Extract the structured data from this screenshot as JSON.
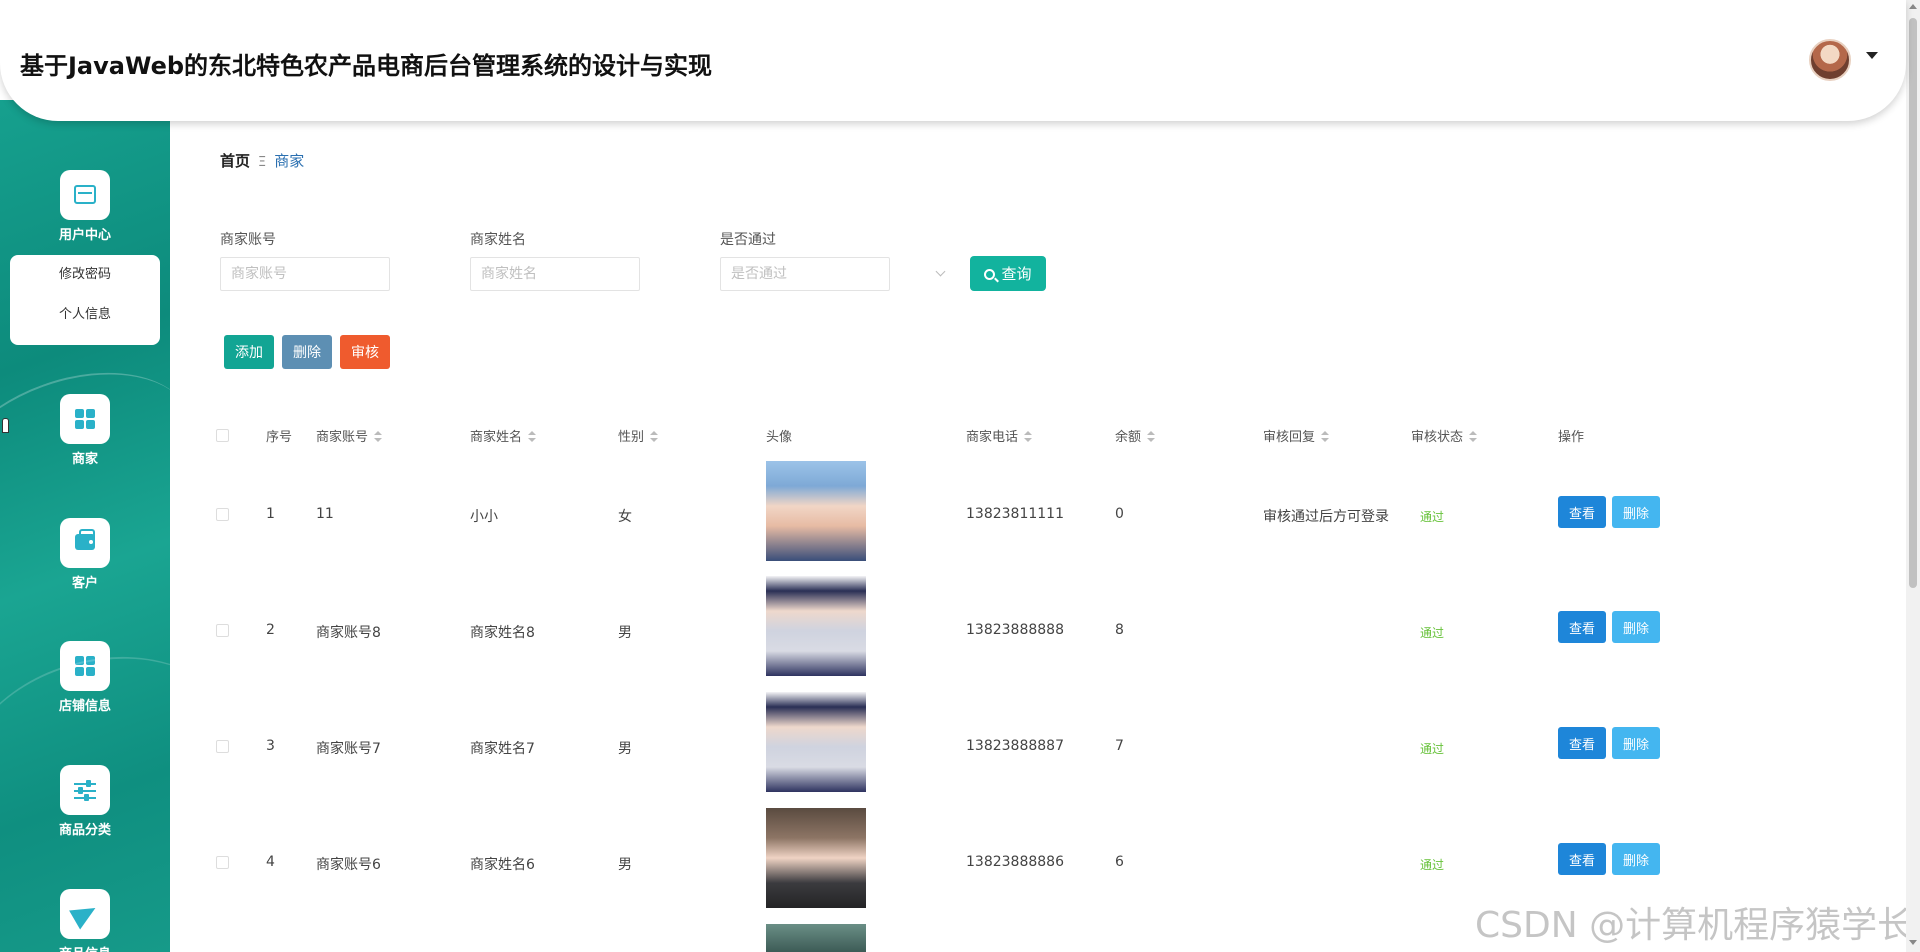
{
  "header": {
    "title": "基于JavaWeb的东北特色农产品电商后台管理系统的设计与实现"
  },
  "sidebar": {
    "items": [
      {
        "label": "用户中心",
        "icon": "card-icon"
      },
      {
        "label": "商家",
        "icon": "grid-icon"
      },
      {
        "label": "客户",
        "icon": "wallet-icon"
      },
      {
        "label": "店铺信息",
        "icon": "grid-icon"
      },
      {
        "label": "商品分类",
        "icon": "sliders-icon"
      },
      {
        "label": "商品信息",
        "icon": "send-icon"
      }
    ],
    "submenu": [
      "修改密码",
      "个人信息"
    ]
  },
  "breadcrumb": {
    "home": "首页",
    "separator": "Ξ",
    "current": "商家"
  },
  "filters": {
    "account": {
      "label": "商家账号",
      "placeholder": "商家账号"
    },
    "name": {
      "label": "商家姓名",
      "placeholder": "商家姓名"
    },
    "passed": {
      "label": "是否通过",
      "placeholder": "是否通过"
    },
    "search_label": "查询"
  },
  "actions": {
    "add": "添加",
    "delete": "删除",
    "audit": "审核"
  },
  "table": {
    "headers": {
      "index": "序号",
      "account": "商家账号",
      "name": "商家姓名",
      "gender": "性别",
      "avatar": "头像",
      "phone": "商家电话",
      "balance": "余额",
      "reply": "审核回复",
      "status": "审核状态",
      "ops": "操作"
    },
    "rows": [
      {
        "index": "1",
        "account": "11",
        "name": "小小",
        "gender": "女",
        "phone": "13823811111",
        "balance": "0",
        "reply": "审核通过后方可登录",
        "status": "通过"
      },
      {
        "index": "2",
        "account": "商家账号8",
        "name": "商家姓名8",
        "gender": "男",
        "phone": "13823888888",
        "balance": "8",
        "reply": "",
        "status": "通过"
      },
      {
        "index": "3",
        "account": "商家账号7",
        "name": "商家姓名7",
        "gender": "男",
        "phone": "13823888887",
        "balance": "7",
        "reply": "",
        "status": "通过"
      },
      {
        "index": "4",
        "account": "商家账号6",
        "name": "商家姓名6",
        "gender": "男",
        "phone": "13823888886",
        "balance": "6",
        "reply": "",
        "status": "通过"
      }
    ],
    "view_label": "查看",
    "delete_label": "删除"
  },
  "watermark": "CSDN @计算机程序猿学长",
  "colors": {
    "accent": "#12b39e",
    "sidebar": "#109483",
    "delete_batch": "#5d8fb3",
    "audit": "#ef5b2e",
    "view": "#1e86d9",
    "row_delete": "#44b6f0",
    "status_pass": "#67c23a"
  }
}
